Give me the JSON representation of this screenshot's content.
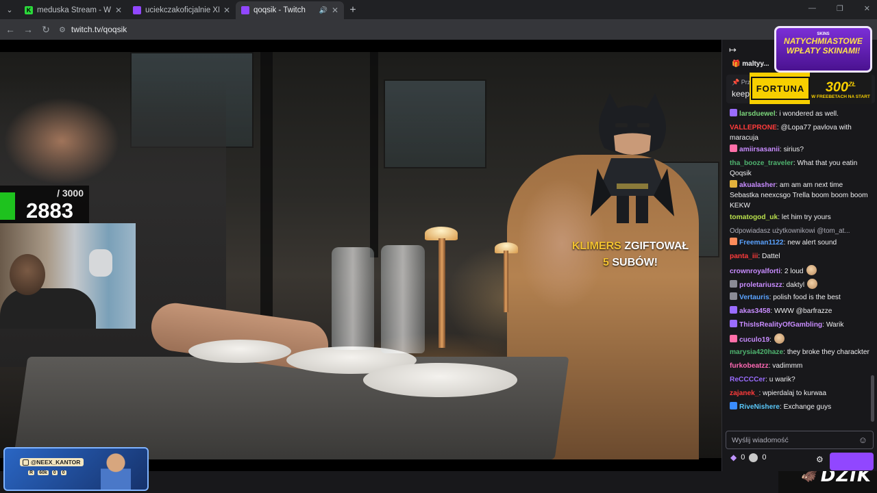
{
  "browser": {
    "tabs": [
      {
        "title": "meduska Stream - Watch Live o",
        "favicon_color": "#2bd93b",
        "favicon_glyph": "K",
        "active": false
      },
      {
        "title": "uciekczakoficjalnie XD - Twitch",
        "favicon_color": "#9147ff",
        "favicon_glyph": "",
        "active": false
      },
      {
        "title": "qoqsik - Twitch",
        "favicon_color": "#9147ff",
        "favicon_glyph": "",
        "active": true
      }
    ],
    "new_tab": "+",
    "url": "twitch.tv/qoqsik"
  },
  "stream": {
    "sub_goal": "/ 3000",
    "sub_count": "2883",
    "alert_name": "KLIMERS",
    "alert_verb": "ZGIFTOWAŁ",
    "alert_count": "5",
    "alert_unit": "SUBÓW!"
  },
  "promo_card": {
    "handle": "@NEEX_KANTOR",
    "badges": [
      "R",
      "60k",
      "0",
      "0"
    ]
  },
  "promo_banner": {
    "brand": "SKINS",
    "line1": "NATYCHMIASTOWE",
    "line2": "WPŁATY SKINAMI!"
  },
  "fortuna": {
    "name": "FORTUNA",
    "amount": "300",
    "currency": "ZŁ",
    "subtitle": "W FREEBETACH NA START"
  },
  "dzik": {
    "label": "DZIK"
  },
  "chat": {
    "hype_user": "maltyy...",
    "pinned_label": "Prz",
    "pinned_text": "keep",
    "messages": [
      {
        "user": "larsduewel",
        "color": "#7bd67b",
        "badge": "#9a6cff",
        "text": ": i wondered as well."
      },
      {
        "user": "VALLEPRONE",
        "color": "#ff3b3b",
        "badge": "",
        "text": ": @Lopa77 pavlova with maracuja"
      },
      {
        "user": "amiirsasanii",
        "color": "#c88cff",
        "badge": "#ff6fa8",
        "text": ": sirius?"
      },
      {
        "user": "tha_booze_traveler",
        "color": "#4fb36f",
        "badge": "",
        "text": ": What that you eatin Qoqsik"
      },
      {
        "user": "akualasher",
        "color": "#c88cff",
        "badge": "#e3b23c",
        "text": ": am am am next time Sebastka neexcsgo Trella boom boom boom KEKW"
      },
      {
        "user": "tomatogod_uk",
        "color": "#b9e04c",
        "badge": "",
        "text": ": let him try yours"
      },
      {
        "user": "Freeman1122",
        "color": "#5aa2ff",
        "badge": "#ff8c5a",
        "text": ": new alert sound",
        "reply": "Odpowiadasz użytkownikowi @tom_at..."
      },
      {
        "user": "panta_iii",
        "color": "#ff3b3b",
        "badge": "",
        "text": ": Dattel"
      },
      {
        "user": "crownroyalforti",
        "color": "#c88cff",
        "badge": "",
        "text": ": 2 loud",
        "emote": true
      },
      {
        "user": "proletariuszz",
        "color": "#c88cff",
        "badge": "#8b8b95",
        "text": ": daktyl",
        "emote": true
      },
      {
        "user": "Vertauris",
        "color": "#5aa2ff",
        "badge": "#8b8b95",
        "text": ": polish food is the best"
      },
      {
        "user": "akas3458",
        "color": "#c88cff",
        "badge": "#9a6cff",
        "text": ": WWW @barfrazze"
      },
      {
        "user": "ThisIsRealityOfGambling",
        "color": "#c88cff",
        "badge": "#9a6cff",
        "text": ": Warik"
      },
      {
        "user": "cuculo19",
        "color": "#c88cff",
        "badge": "#ff6fa8",
        "text": ":",
        "emote": true
      },
      {
        "user": "marysia420haze",
        "color": "#4fb36f",
        "badge": "",
        "text": ": they broke they charackter"
      },
      {
        "user": "furkobeatzz",
        "color": "#ff69b4",
        "badge": "",
        "text": ": vadimmm"
      },
      {
        "user": "ReCCCCer",
        "color": "#9a6cff",
        "badge": "",
        "text": ": u warik?"
      },
      {
        "user": "zajanek_",
        "color": "#ff3b3b",
        "badge": "",
        "text": ": wpierdalaj to kurwaa"
      },
      {
        "user": "RiveNishere",
        "color": "#5ac8fa",
        "badge": "#3a8cff",
        "text": ": Exchange guys"
      }
    ],
    "input_placeholder": "Wyślij wiadomość",
    "points": "0",
    "coins": "0"
  }
}
